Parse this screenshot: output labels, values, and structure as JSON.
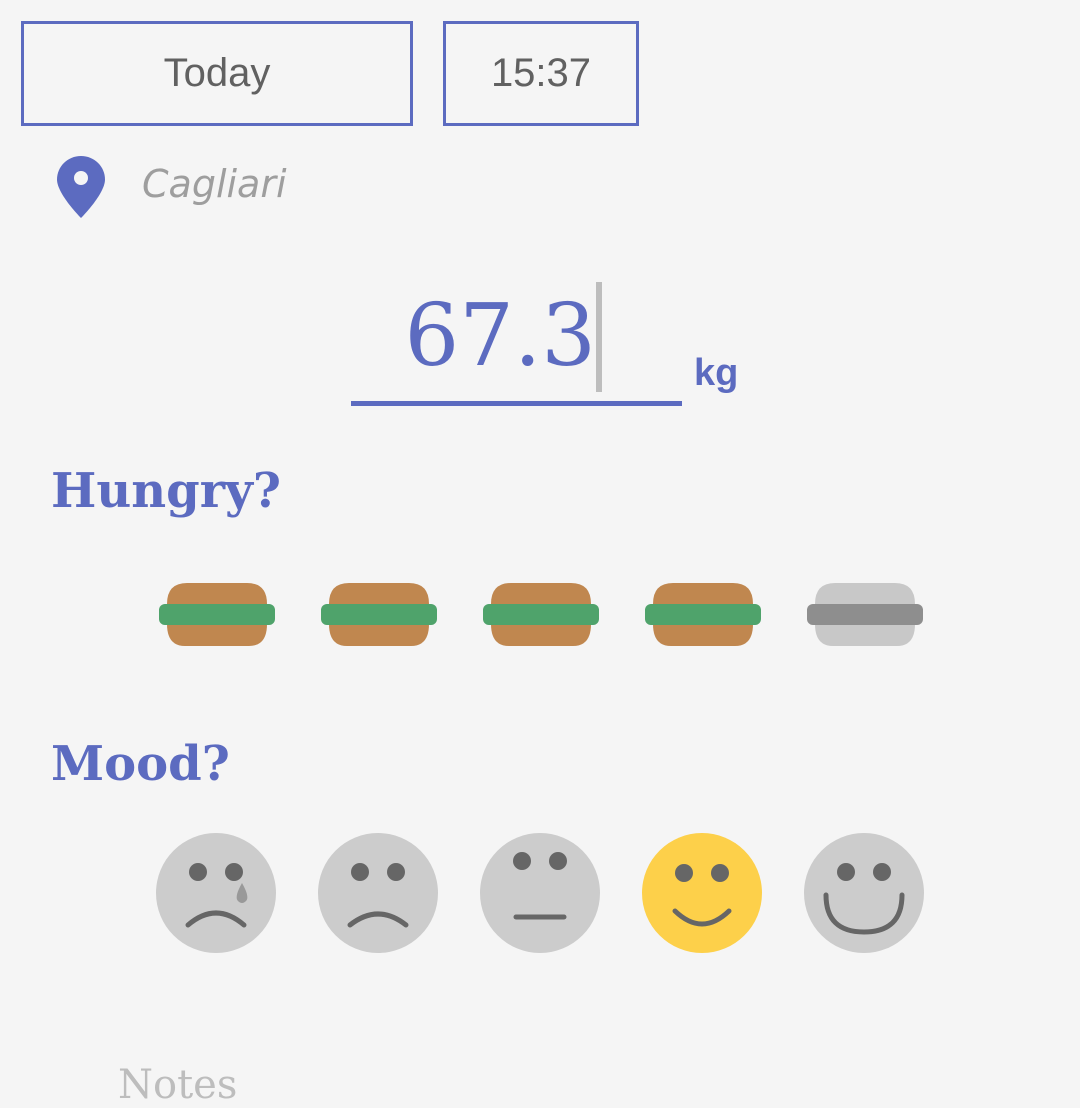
{
  "header": {
    "date_label": "Today",
    "time_label": "15:37"
  },
  "location": {
    "icon": "map-pin-icon",
    "name": "Cagliari"
  },
  "weight": {
    "value": "67.3",
    "unit": "kg"
  },
  "hunger": {
    "title": "Hungry?",
    "icon": "burger-icon",
    "level": 4,
    "max": 5
  },
  "mood": {
    "title": "Mood?",
    "faces": [
      "crying-face-icon",
      "sad-face-icon",
      "neutral-face-icon",
      "smile-face-icon",
      "big-smile-face-icon"
    ],
    "selected_index": 3
  },
  "notes": {
    "label": "Notes"
  },
  "colors": {
    "accent": "#5c6bc0",
    "bun": "#c0874f",
    "lettuce": "#4fa36b",
    "inactive_bun": "#c8c8c8",
    "inactive_lettuce": "#8e8e8e",
    "mood_selected": "#fdd04a",
    "mood_inactive": "#cccccc",
    "face_features": "#666666",
    "background": "#f5f5f5"
  }
}
